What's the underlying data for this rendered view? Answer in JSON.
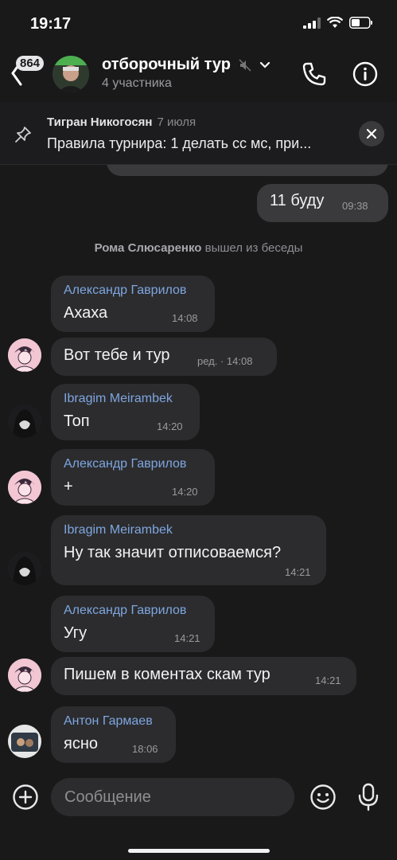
{
  "status": {
    "time": "19:17"
  },
  "header": {
    "unread_count": "864",
    "title": "отборочный тур",
    "subtitle": "4 участника"
  },
  "pinned": {
    "author": "Тигран Никогосян",
    "date": "7 июля",
    "text": "Правила турнира: 1 делать сс мс, при..."
  },
  "messages": [
    {
      "id": "m1",
      "text": "11 буду",
      "time": "09:38",
      "outgoing": true
    },
    {
      "id": "sys",
      "system_name": "Рома Слюсаренко",
      "system_text": "вышел из беседы"
    },
    {
      "id": "m2",
      "sender": "Александр Гаврилов",
      "text": "Ахаха",
      "time": "14:08"
    },
    {
      "id": "m3",
      "text": "Вот тебе и тур",
      "time": "ред. · 14:08"
    },
    {
      "id": "m4",
      "sender": "Ibragim Meirambek",
      "text": "Топ",
      "time": "14:20"
    },
    {
      "id": "m5",
      "sender": "Александр Гаврилов",
      "text": "+",
      "time": "14:20"
    },
    {
      "id": "m6",
      "sender": "Ibragim Meirambek",
      "text": "Ну так значит отписоваемся?",
      "time": "14:21"
    },
    {
      "id": "m7",
      "sender": "Александр Гаврилов",
      "text": "Угу",
      "time": "14:21"
    },
    {
      "id": "m8",
      "text": "Пишем в коментах скам тур",
      "time": "14:21"
    },
    {
      "id": "m9",
      "sender": "Антон Гармаев",
      "text": "ясно",
      "time": "18:06"
    }
  ],
  "composer": {
    "placeholder": "Сообщение"
  },
  "icons": {
    "back": "chevron-left-icon",
    "mute": "muted-speaker-icon",
    "dropdown": "chevron-down-icon",
    "call": "phone-icon",
    "info": "info-icon",
    "pin": "pin-icon",
    "close": "close-icon",
    "attach": "plus-circle-icon",
    "emoji": "smile-icon",
    "mic": "microphone-icon"
  },
  "colors": {
    "background": "#19191a",
    "bubble_in": "#2c2c2e",
    "bubble_out": "#3a3a3c",
    "sender_name": "#7ea6e0"
  }
}
